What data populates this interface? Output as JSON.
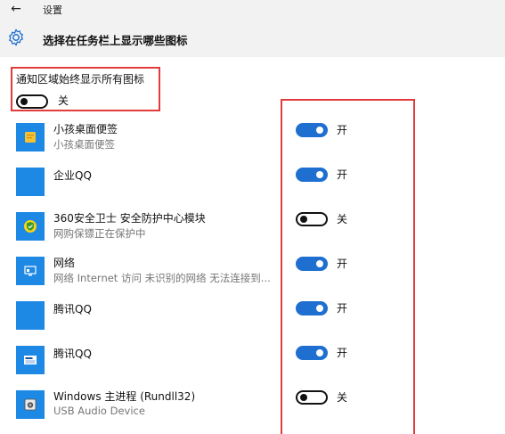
{
  "window": {
    "back_glyph": "←",
    "title": "设置"
  },
  "header": {
    "icon": "gear-icon",
    "title": "选择在任务栏上显示哪些图标"
  },
  "always_show": {
    "label": "通知区域始终显示所有图标",
    "state": "关",
    "on": false
  },
  "colors": {
    "accent": "#1e6fd0",
    "icon_bg": "#1e88e5",
    "highlight": "#e23b3b",
    "subtext": "#767676"
  },
  "apps": [
    {
      "name": "小孩桌面便签",
      "sub": "小孩桌面便签",
      "icon": "sticky-note-icon",
      "state": "开",
      "on": true
    },
    {
      "name": "企业QQ",
      "sub": "",
      "icon": "blank-app-icon",
      "state": "开",
      "on": true
    },
    {
      "name": "360安全卫士 安全防护中心模块",
      "sub": "网购保镖正在保护中",
      "icon": "shield-360-icon",
      "state": "关",
      "on": false
    },
    {
      "name": "网络",
      "sub": "网络 Internet 访问  未识别的网络 无法连接到...",
      "icon": "network-icon",
      "state": "开",
      "on": true
    },
    {
      "name": "腾讯QQ",
      "sub": "",
      "icon": "blank-app-icon",
      "state": "开",
      "on": true
    },
    {
      "name": "腾讯QQ",
      "sub": "",
      "icon": "volume-app-icon",
      "state": "开",
      "on": true
    },
    {
      "name": "Windows 主进程 (Rundll32)",
      "sub": "USB Audio Device",
      "icon": "speaker-icon",
      "state": "关",
      "on": false
    }
  ]
}
